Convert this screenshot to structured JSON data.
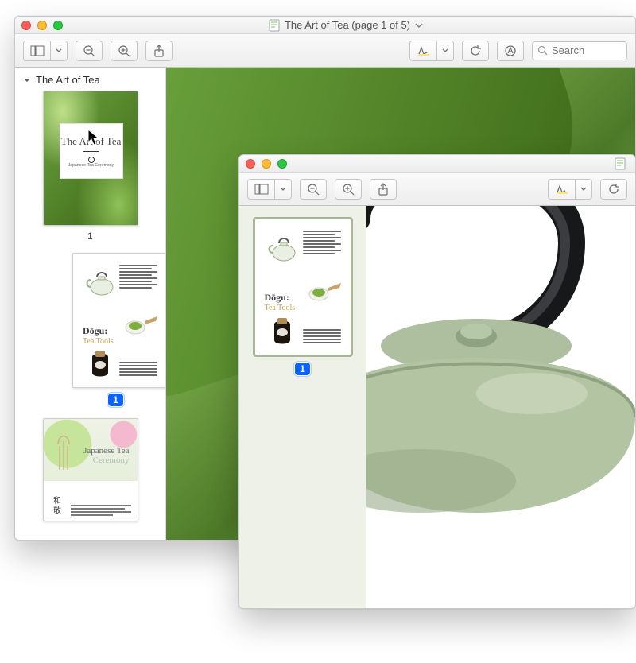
{
  "window1": {
    "title": "The Art of Tea (page 1 of 5)",
    "search_placeholder": "Search",
    "outline_title": "The Art of Tea",
    "thumbs": [
      {
        "label": "1",
        "cover_title": "The Art of Tea",
        "cover_subtitle": "Japanese Tea Ceremony"
      },
      {
        "label": "1",
        "heading": "Dōgu:",
        "subheading": "Tea Tools"
      },
      {
        "heading": "Japanese Tea",
        "subheading": "Ceremony"
      }
    ]
  },
  "window2": {
    "thumbs": [
      {
        "label": "1",
        "heading": "Dōgu:",
        "subheading": "Tea Tools"
      }
    ]
  }
}
